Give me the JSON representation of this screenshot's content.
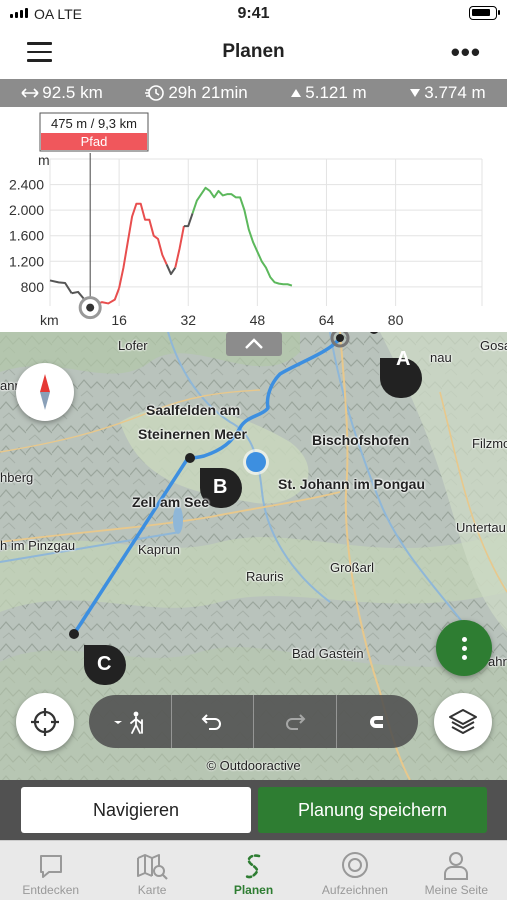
{
  "status_bar": {
    "carrier": "OA  LTE",
    "time": "9:41"
  },
  "header": {
    "title": "Planen",
    "menu_icon": "hamburger-icon",
    "more_icon": "ellipsis-icon"
  },
  "stats": {
    "distance": "92.5 km",
    "duration": "29h 21min",
    "ascent": "5.121 m",
    "descent": "3.774 m"
  },
  "chart_data": {
    "type": "line",
    "ylabel": "m",
    "xlabel": "km",
    "y_ticks": [
      "2.400",
      "2.000",
      "1.600",
      "1.200",
      "800"
    ],
    "x_ticks": [
      "16",
      "32",
      "48",
      "64",
      "80"
    ],
    "ylim": [
      500,
      2800
    ],
    "xlim": [
      0,
      92.5
    ],
    "tooltip": {
      "value": "475 m / 9,3 km",
      "label": "Pfad",
      "x": 9.3
    },
    "series": [
      {
        "color_note": "segment colors vary by surface type",
        "x": [
          0,
          2,
          3.5,
          5,
          6.5,
          8,
          9.3,
          10.5,
          12,
          13.5,
          15,
          16,
          17,
          18,
          19,
          20,
          21,
          22,
          23,
          24,
          25,
          26,
          27,
          28,
          29,
          30,
          31,
          32,
          33,
          34,
          35,
          36,
          37,
          38,
          39,
          40,
          41,
          42,
          43,
          44,
          45,
          46,
          47,
          48,
          49,
          50,
          51,
          52,
          53,
          54,
          55,
          56
        ],
        "y": [
          900,
          870,
          860,
          700,
          720,
          600,
          475,
          520,
          560,
          540,
          600,
          780,
          1100,
          1500,
          1900,
          2100,
          2100,
          1850,
          1850,
          1600,
          1550,
          1300,
          1150,
          1000,
          1100,
          1400,
          1750,
          1750,
          1950,
          2150,
          2250,
          2350,
          2300,
          2200,
          2300,
          2230,
          2250,
          2250,
          2200,
          2200,
          2000,
          1700,
          1500,
          1350,
          1200,
          1100,
          950,
          870,
          850,
          840,
          840,
          820
        ]
      }
    ],
    "segments": [
      {
        "from": 0,
        "to": 5,
        "color": "#555555"
      },
      {
        "from": 5,
        "to": 9.3,
        "color": "#555555"
      },
      {
        "from": 9.3,
        "to": 16,
        "color": "#e84e4e"
      },
      {
        "from": 16,
        "to": 27,
        "color": "#e84e4e"
      },
      {
        "from": 27,
        "to": 29,
        "color": "#555555"
      },
      {
        "from": 29,
        "to": 31,
        "color": "#e84e4e"
      },
      {
        "from": 31,
        "to": 33,
        "color": "#555555"
      },
      {
        "from": 33,
        "to": 56,
        "color": "#5cb85c"
      }
    ]
  },
  "map": {
    "places": [
      {
        "name": "Lofer",
        "cls": ""
      },
      {
        "name": "Saalfelden am",
        "cls": "mid"
      },
      {
        "name": "Steinernen Meer",
        "cls": "mid"
      },
      {
        "name": "Bischofshofen",
        "cls": "mid"
      },
      {
        "name": "St. Johann im Pongau",
        "cls": "mid"
      },
      {
        "name": "Zell am See",
        "cls": "mid"
      },
      {
        "name": "Kaprun",
        "cls": ""
      },
      {
        "name": "Rauris",
        "cls": ""
      },
      {
        "name": "Großarl",
        "cls": ""
      },
      {
        "name": "Bad Gastein",
        "cls": ""
      },
      {
        "name": "Filzmo",
        "cls": ""
      },
      {
        "name": "Untertau",
        "cls": ""
      },
      {
        "name": "hberg",
        "cls": ""
      },
      {
        "name": "h im Pinzgau",
        "cls": ""
      },
      {
        "name": "Gosa",
        "cls": ""
      },
      {
        "name": "nau",
        "cls": ""
      },
      {
        "name": "ahr",
        "cls": ""
      },
      {
        "name": "ann",
        "cls": ""
      }
    ],
    "waypoints": [
      "A",
      "B",
      "C"
    ],
    "copyright": "© Outdooractive",
    "compass_icon": "compass-icon",
    "locate_icon": "crosshair-icon",
    "layers_icon": "layers-icon",
    "collapse_icon": "chevron-up-icon",
    "tools": [
      "hiker-mode-icon",
      "undo-icon",
      "redo-icon",
      "magnet-icon"
    ]
  },
  "actions": {
    "navigate": "Navigieren",
    "save": "Planung speichern"
  },
  "tabs": [
    {
      "label": "Entdecken",
      "icon": "speech-bubble-icon"
    },
    {
      "label": "Karte",
      "icon": "map-search-icon"
    },
    {
      "label": "Planen",
      "icon": "route-s-icon"
    },
    {
      "label": "Aufzeichnen",
      "icon": "record-icon"
    },
    {
      "label": "Meine Seite",
      "icon": "user-icon"
    }
  ],
  "colors": {
    "accent_green": "#2e7d32",
    "route_blue": "#3d8fe0",
    "stats_gray": "#8c8c8c",
    "tooltip_red": "#f0575c"
  }
}
